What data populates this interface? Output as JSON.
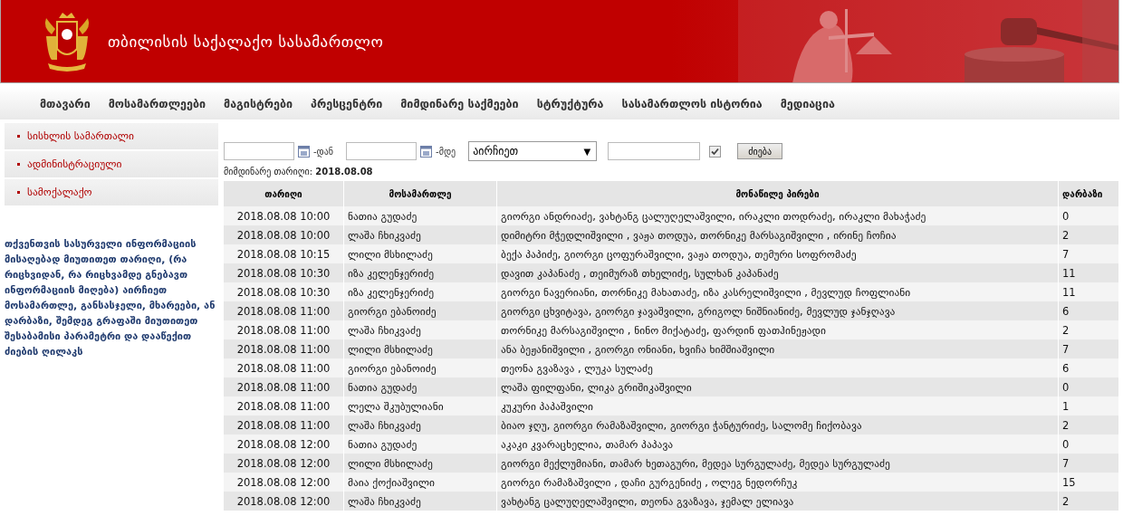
{
  "site_title": "თბილისის საქალაქო სასამართლო",
  "nav": [
    {
      "label": "მთავარი"
    },
    {
      "label": "მოსამართლეები"
    },
    {
      "label": "მაგისტრები"
    },
    {
      "label": "პრესცენტრი"
    },
    {
      "label": "მიმდინარე საქმეები"
    },
    {
      "label": "სტრუქტურა"
    },
    {
      "label": "სასამართლოს ისტორია"
    },
    {
      "label": "მედიაცია"
    }
  ],
  "sidebar": {
    "items": [
      {
        "label": "სისხლის სამართალი"
      },
      {
        "label": "ადმინისტრაციული"
      },
      {
        "label": "სამოქალაქო"
      }
    ],
    "help": "თქვენთვის სასურველი ინფორმაციის მისაღებად მიუთითეთ თარიღი, (რა რიცხვიდან, რა რიცხვამდე გნებავთ ინფორმაციის მიღება) აირჩიეთ მოსამართლე, განსასჯელი,  მხარეები, ან დარბაზი, შემდეგ გრაფაში მიუთითეთ შესაბამისი პარამეტრი და დააწექით ძიების ღილაკს"
  },
  "filter": {
    "from_label": "-დან",
    "to_label": "-მდე",
    "select": "აირჩიეთ",
    "select_arrow": "▼",
    "checkbox_checked": true,
    "button": "ძიება",
    "current_date_label": "მიმდინარე თარიღი:",
    "current_date": "2018.08.08"
  },
  "table": {
    "columns": [
      "თარიღი",
      "მოსამართლე",
      "მონაწილე პირები",
      "დარბაზი"
    ],
    "rows": [
      [
        "2018.08.08 10:00",
        "ნათია გუდაძე",
        "გიორგი ანდრიაძე, ვახტანგ ცალუღელაშვილი, ირაკლი თოდრაძე, ირაკლი მახაჭაძე",
        "0"
      ],
      [
        "2018.08.08 10:00",
        "ლაშა ჩხიკვაძე",
        "დიმიტრი მჭედლიშვილი , ვაჟა თოდუა, თორნიკე მარსაგიშვილი , ირინე ჩოჩია",
        "2"
      ],
      [
        "2018.08.08 10:15",
        "ლილი მსხილაძე",
        "ბექა პაპიძე, გიორგი ცოფურაშვილი, ვაჟა თოდუა, თემური სოფრომაძე",
        "7"
      ],
      [
        "2018.08.08 10:30",
        "იზა კელენჯერიძე",
        "დავით კაპანაძე , თეიმურაზ თხელიძე, სულხან კაპანაძე",
        "11"
      ],
      [
        "2018.08.08 10:30",
        "იზა კელენჯერიძე",
        "გიორგი ნავერიანი, თორნიკე მახათაძე, იზა კასრელიშვილი , მევლუდ ჩოფლიანი",
        "11"
      ],
      [
        "2018.08.08 11:00",
        "გიორგი ებანოიძე",
        "გიორგი ცხვიტავა, გიორგი ჯავაშვილი, გრიგოლ ნიშნიანიძე, მევლუდ ჯანჯღავა",
        "6"
      ],
      [
        "2018.08.08 11:00",
        "ლაშა ჩხიკვაძე",
        "თორნიკე მარსაგიშვილი , ნინო მიქატაძე, ფარდინ ფათჰინეჟადი",
        "2"
      ],
      [
        "2018.08.08 11:00",
        "ლილი მსხილაძე",
        "ანა ბეჟანიშვილი , გიორგი ონიანი, ხვიჩა ხიმშიაშვილი",
        "7"
      ],
      [
        "2018.08.08 11:00",
        "გიორგი ებანოიძე",
        "თეონა გვაზავა , ლუკა სულაძე",
        "6"
      ],
      [
        "2018.08.08 11:00",
        "ნათია გუდაძე",
        "ლაშა ფილფანი, ლიკა გრიშიკაშვილი",
        "0"
      ],
      [
        "2018.08.08 11:00",
        "ლელა შკუბულიანი",
        "კუკური პაპაშვილი",
        "1"
      ],
      [
        "2018.08.08 11:00",
        "ლაშა ჩხიკვაძე",
        "ბიაო ჯღუ, გიორგი რამაზაშვილი, გიორგი ჭანტურიძე, სალომე ჩიქობავა",
        "2"
      ],
      [
        "2018.08.08 12:00",
        "ნათია გუდაძე",
        "აკაკი კვარაცხელია, თამარ პაპავა",
        "0"
      ],
      [
        "2018.08.08 12:00",
        "ლილი მსხილაძე",
        "გიორგი მექლუმიანი, თამარ ხეთაგური, მედეა სურგულაძე, მედეა სურგულაძე",
        "7"
      ],
      [
        "2018.08.08 12:00",
        "მაია ქოქიაშვილი",
        "გიორგი რამაზაშვილი , დაჩი გურგენიძე , ოლეგ ნედორჩუკ",
        "15"
      ],
      [
        "2018.08.08 12:00",
        "ლაშა ჩხიკვაძე",
        "ვახტანგ ცალუღელაშვილი, თეონა გვაზავა, ჯემალ ელიავა",
        "2"
      ]
    ]
  }
}
